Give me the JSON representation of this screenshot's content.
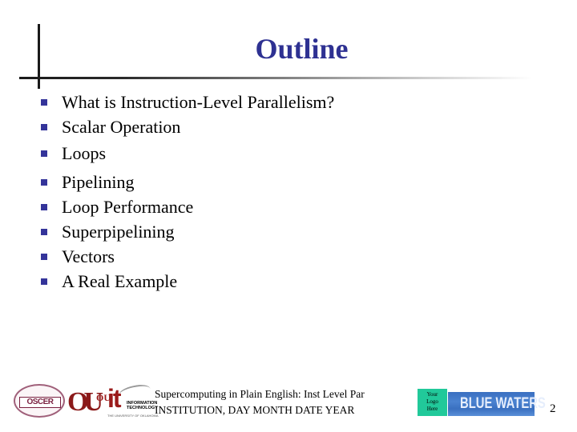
{
  "slide": {
    "title": "Outline",
    "bullets": [
      "What is Instruction-Level Parallelism?",
      "Scalar Operation",
      "Loops",
      "Pipelining",
      "Loop Performance",
      "Superpipelining",
      "Vectors",
      "A Real Example"
    ],
    "title_color": "#2e3192",
    "bullet_color": "#34349a"
  },
  "footer": {
    "line1": "Supercomputing in Plain English: Inst Level Par",
    "line2": "INSTITUTION, DAY MONTH DATE YEAR",
    "page_number": "2",
    "logos": {
      "oscer": "OSCER",
      "ou": "OU",
      "it": "it",
      "it_ou": "OU",
      "it_subtitle_1": "INFORMATION",
      "it_subtitle_2": "TECHNOLOGY",
      "it_tagline": "THE UNIVERSITY OF OKLAHOMA",
      "your_logo": [
        "Your",
        "Logo",
        "Here"
      ],
      "blue_waters": "BLUE WATERS"
    }
  }
}
